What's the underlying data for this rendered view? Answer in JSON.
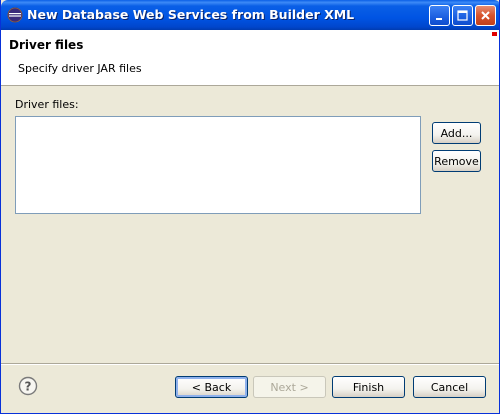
{
  "window": {
    "title": "New Database Web Services from Builder XML",
    "title_icon": "eclipse-icon",
    "controls": [
      "minimize-icon",
      "maximize-icon",
      "close-icon"
    ]
  },
  "header": {
    "title": "Driver files",
    "description": "Specify driver JAR files"
  },
  "driver_files": {
    "label": "Driver files:",
    "items": [],
    "add_label": "Add...",
    "remove_label": "Remove"
  },
  "footer": {
    "help_icon": "help-icon",
    "back_label": "< Back",
    "next_label": "Next >",
    "finish_label": "Finish",
    "cancel_label": "Cancel"
  }
}
